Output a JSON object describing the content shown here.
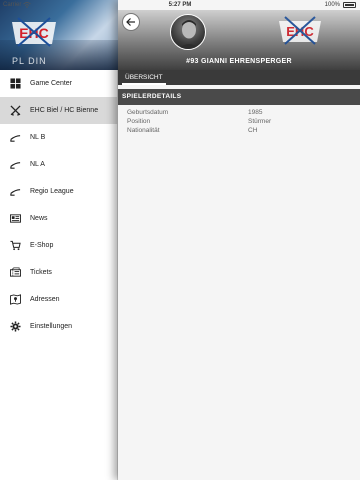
{
  "status_bar": {
    "carrier": "Carrier",
    "time": "5:27 PM",
    "battery": "100%"
  },
  "sidebar": {
    "banner_caption": "PL DIN",
    "items": [
      {
        "label": "Game Center",
        "icon": "grid-icon",
        "active": false
      },
      {
        "label": "EHC Biel / HC Bienne",
        "icon": "crossed-sticks-icon",
        "active": true
      },
      {
        "label": "NL B",
        "icon": "hockey-stick-icon",
        "active": false
      },
      {
        "label": "NL A",
        "icon": "hockey-stick-icon",
        "active": false
      },
      {
        "label": "Regio League",
        "icon": "hockey-stick-icon",
        "active": false
      },
      {
        "label": "News",
        "icon": "newspaper-icon",
        "active": false
      },
      {
        "label": "E-Shop",
        "icon": "cart-icon",
        "active": false
      },
      {
        "label": "Tickets",
        "icon": "ticket-icon",
        "active": false
      },
      {
        "label": "Adressen",
        "icon": "map-icon",
        "active": false
      },
      {
        "label": "Einstellungen",
        "icon": "gear-icon",
        "active": false
      }
    ]
  },
  "player": {
    "name": "#93 GIANNI EHRENSPERGER"
  },
  "tabs": [
    {
      "label": "ÜBERSICHT",
      "active": true
    }
  ],
  "section": {
    "title": "SPIELERDETAILS"
  },
  "details": [
    {
      "label": "Geburtsdatum",
      "value": "1985"
    },
    {
      "label": "Position",
      "value": "Stürmer"
    },
    {
      "label": "Nationalität",
      "value": "CH"
    }
  ],
  "colors": {
    "logo_blue": "#1d4f9a",
    "logo_red": "#d4202a",
    "header_dark": "#3a3a3a"
  }
}
